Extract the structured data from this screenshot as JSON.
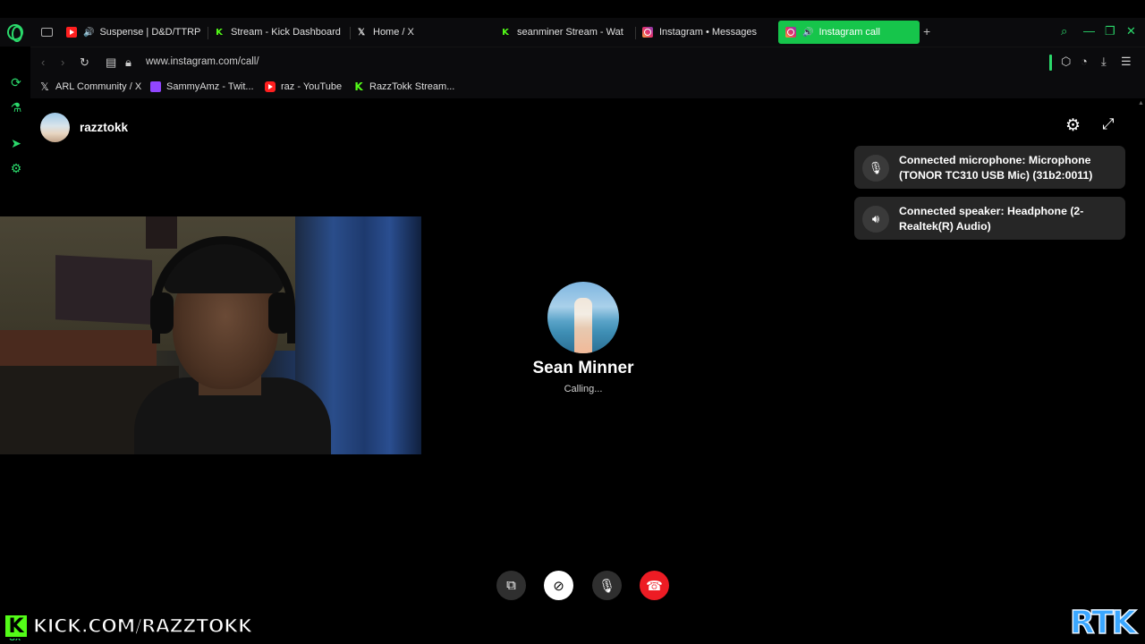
{
  "tabs": [
    {
      "label": "Suspense | D&D/TTRP",
      "icon": "youtube-icon",
      "audio": true
    },
    {
      "label": "Stream - Kick Dashboard",
      "icon": "kick-icon"
    },
    {
      "label": "Home / X",
      "icon": "x-icon"
    },
    {
      "label": "seanminer Stream - Watc",
      "icon": "kick-icon"
    },
    {
      "label": "Instagram • Messages",
      "icon": "instagram-icon"
    },
    {
      "label": "Instagram call",
      "icon": "instagram-icon",
      "audio": true,
      "active": true
    }
  ],
  "address": {
    "url": "www.instagram.com/call/"
  },
  "bookmarks": [
    {
      "label": "ARL Community / X",
      "icon": "x-icon"
    },
    {
      "label": "SammyAmz - Twit...",
      "icon": "twitch-icon"
    },
    {
      "label": "raz - YouTube",
      "icon": "youtube-icon"
    },
    {
      "label": "RazzTokk Stream...",
      "icon": "kick-icon"
    }
  ],
  "sidebar": {
    "gx_label": "GX"
  },
  "call": {
    "caller_name": "razztokk",
    "callee_name": "Sean Minner",
    "status": "Calling..."
  },
  "notifications": [
    {
      "icon": "microphone-icon",
      "text": "Connected microphone: Microphone (TONOR TC310 USB Mic) (31b2:0011)"
    },
    {
      "icon": "speaker-icon",
      "text": "Connected speaker: Headphone (2- Realtek(R) Audio)"
    }
  ],
  "overlay": {
    "kick_url": "KICK.COM/RAZZTOKK",
    "brand": "RTK"
  },
  "colors": {
    "accent": "#2bd96b",
    "active_tab": "#16c54b",
    "end_call": "#ed1c24",
    "kick": "#53fc18"
  }
}
